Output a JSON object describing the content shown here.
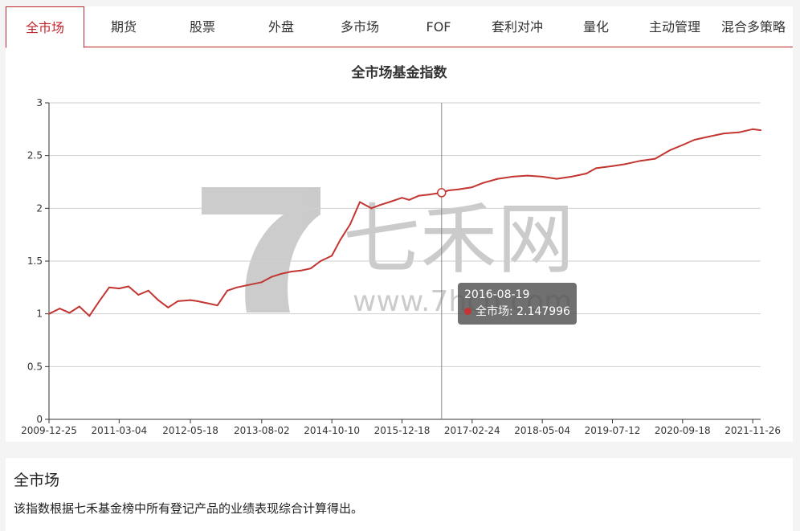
{
  "tabs": [
    {
      "label": "全市场",
      "active": true
    },
    {
      "label": "期货",
      "active": false
    },
    {
      "label": "股票",
      "active": false
    },
    {
      "label": "外盘",
      "active": false
    },
    {
      "label": "多市场",
      "active": false
    },
    {
      "label": "FOF",
      "active": false
    },
    {
      "label": "套利对冲",
      "active": false
    },
    {
      "label": "量化",
      "active": false
    },
    {
      "label": "主动管理",
      "active": false
    },
    {
      "label": "混合多策略",
      "active": false
    }
  ],
  "watermark": {
    "brand": "七禾网",
    "url": "www.7hcn.com"
  },
  "chart_data": {
    "type": "line",
    "title": "全市场基金指数",
    "xlabel": "",
    "ylabel": "",
    "ylim": [
      0,
      3
    ],
    "yticks": [
      "0",
      "0.5",
      "1",
      "1.5",
      "2",
      "2.5",
      "3"
    ],
    "xticks": [
      "2009-12-25",
      "2011-03-04",
      "2012-05-18",
      "2013-08-02",
      "2014-10-10",
      "2015-12-18",
      "2017-02-24",
      "2018-05-04",
      "2019-07-12",
      "2020-09-18",
      "2021-11-26"
    ],
    "grid": true,
    "line_color": "#c23531",
    "series": [
      {
        "name": "全市场",
        "x": [
          "2009-12-25",
          "2010-03-01",
          "2010-05-01",
          "2010-07-01",
          "2010-09-01",
          "2010-11-01",
          "2011-01-01",
          "2011-03-04",
          "2011-05-01",
          "2011-07-01",
          "2011-09-01",
          "2011-11-01",
          "2012-01-01",
          "2012-03-01",
          "2012-05-18",
          "2012-07-01",
          "2012-09-01",
          "2012-11-01",
          "2013-01-01",
          "2013-03-01",
          "2013-05-01",
          "2013-08-02",
          "2013-10-01",
          "2013-12-01",
          "2014-02-01",
          "2014-04-01",
          "2014-06-01",
          "2014-08-01",
          "2014-10-10",
          "2014-12-01",
          "2015-02-01",
          "2015-04-01",
          "2015-06-12",
          "2015-08-01",
          "2015-10-01",
          "2015-12-18",
          "2016-02-01",
          "2016-04-01",
          "2016-06-01",
          "2016-08-19",
          "2016-10-01",
          "2016-12-01",
          "2017-02-24",
          "2017-05-01",
          "2017-08-01",
          "2017-11-01",
          "2018-02-01",
          "2018-05-04",
          "2018-08-01",
          "2018-11-01",
          "2019-02-01",
          "2019-04-01",
          "2019-07-12",
          "2019-10-01",
          "2020-01-01",
          "2020-04-01",
          "2020-07-01",
          "2020-09-18",
          "2020-12-01",
          "2021-03-01",
          "2021-06-01",
          "2021-09-01",
          "2021-11-26",
          "2022-01-14"
        ],
        "values": [
          1.0,
          1.05,
          1.01,
          1.07,
          0.98,
          1.12,
          1.25,
          1.24,
          1.26,
          1.18,
          1.22,
          1.13,
          1.06,
          1.12,
          1.13,
          1.12,
          1.1,
          1.08,
          1.22,
          1.25,
          1.27,
          1.3,
          1.35,
          1.38,
          1.4,
          1.41,
          1.43,
          1.5,
          1.55,
          1.7,
          1.85,
          2.06,
          2.0,
          2.03,
          2.06,
          2.1,
          2.08,
          2.12,
          2.13,
          2.148,
          2.17,
          2.18,
          2.2,
          2.24,
          2.28,
          2.3,
          2.31,
          2.3,
          2.28,
          2.3,
          2.33,
          2.38,
          2.4,
          2.42,
          2.45,
          2.47,
          2.55,
          2.6,
          2.65,
          2.68,
          2.71,
          2.72,
          2.75,
          2.74
        ]
      }
    ],
    "tooltip": {
      "date": "2016-08-19",
      "series": "全市场",
      "value": "2.147996",
      "label": "全市场: 2.147996"
    }
  },
  "description": {
    "title": "全市场",
    "text": "该指数根据七禾基金榜中所有登记产品的业绩表现综合计算得出。"
  }
}
